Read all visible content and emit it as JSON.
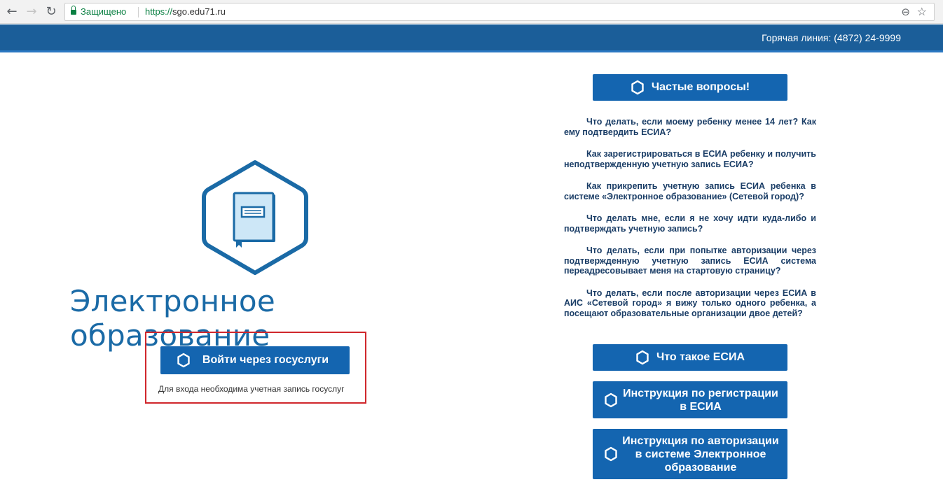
{
  "browser": {
    "secure_label": "Защищено",
    "url_scheme": "https://",
    "url_host": "sgo.edu71.ru"
  },
  "header": {
    "hotline": "Горячая линия: (4872) 24-9999",
    "color": "#1b5e99"
  },
  "logo": {
    "title": "Электронное образование",
    "icon": "book-icon"
  },
  "login": {
    "button_label": "Войти через госуслуги",
    "note": "Для входа необходима учетная запись госуслуг",
    "frame_color": "#d0272c"
  },
  "faq": {
    "button_label": "Частые вопросы!",
    "items": [
      "Что делать, если моему ребенку менее 14 лет? Как ему подтвердить ЕСИА?",
      "Как зарегистрироваться в ЕСИА ребенку и получить неподтвержденную учетную запись ЕСИА?",
      "Как прикрепить учетную запись ЕСИА ребенка в системе «Электронное образование» (Сетевой город)?",
      "Что делать мне, если я не хочу идти куда-либо и подтверждать учетную запись?",
      "Что делать, если при попытке авторизации через подтвержденную учетную запись ЕСИА система переадресовывает меня на стартовую страницу?",
      "Что делать, если после авторизации через ЕСИА в АИС «Сетевой город» я вижу только одного ребенка, а посещают образовательные организации двое детей?"
    ]
  },
  "links": {
    "esia": "Что такое ЕСИА",
    "registration": "Инструкция по регистрации в ЕСИА",
    "authorization": "Инструкция по авторизации в системе Электронное образование"
  },
  "colors": {
    "button": "#1465b0",
    "brand_text": "#1a6aa6"
  }
}
